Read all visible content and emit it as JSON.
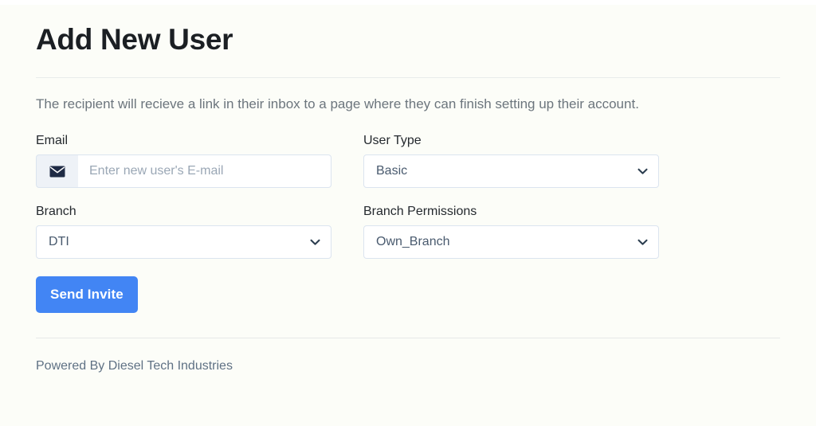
{
  "page": {
    "title": "Add New User",
    "lead": "The recipient will recieve a link in their inbox to a page where they can finish setting up their account."
  },
  "form": {
    "email": {
      "label": "Email",
      "placeholder": "Enter new user's E-mail",
      "value": "",
      "icon": "envelope-icon"
    },
    "user_type": {
      "label": "User Type",
      "value": "Basic",
      "options": [
        "Basic"
      ]
    },
    "branch": {
      "label": "Branch",
      "value": "DTI",
      "options": [
        "DTI"
      ]
    },
    "branch_permissions": {
      "label": "Branch Permissions",
      "value": "Own_Branch",
      "options": [
        "Own_Branch"
      ]
    },
    "submit_label": "Send Invite"
  },
  "footer": {
    "text": "Powered By Diesel Tech Industries"
  },
  "colors": {
    "primary": "#4285f4",
    "background": "#fcfdf8",
    "label_text": "#24292e",
    "muted_text": "#6c757d",
    "border": "#dbe4ef",
    "prepend_bg": "#eef2f7"
  }
}
